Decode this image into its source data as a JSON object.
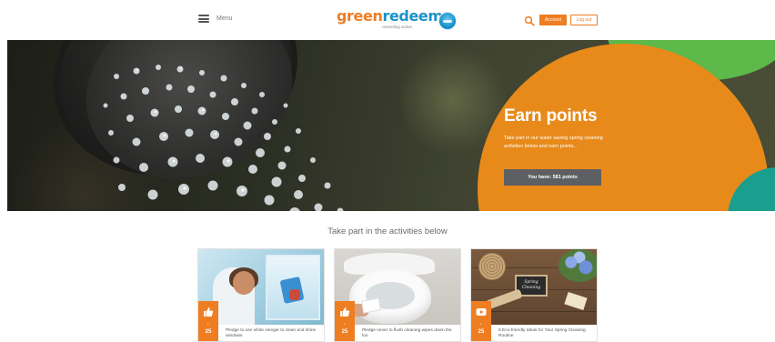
{
  "header": {
    "menu_label": "Menu",
    "logo": {
      "part1": "green",
      "part2": "redeem",
      "tagline": "rewarding action"
    },
    "account_label": "Account",
    "logout_label": "Log out"
  },
  "hero": {
    "title": "Earn points",
    "text": "Take part in our water saving spring cleaning activities below and earn points...",
    "points_button": "You have: 581 points"
  },
  "activities": {
    "title": "Take part in the activities below",
    "cards": [
      {
        "points": "25",
        "icon": "thumbs-up-icon",
        "text": "Pledge to use white vinegar to clean and shine windows"
      },
      {
        "points": "25",
        "icon": "thumbs-up-icon",
        "text": "Pledge never to flush cleaning wipes down the loo"
      },
      {
        "points": "25",
        "icon": "play-icon",
        "text": "5 Eco-friendly Ideas for Your Spring Cleaning Routine",
        "image_sign": "Spring Cleaning"
      }
    ]
  },
  "colors": {
    "brand_orange": "#ef7d22",
    "brand_blue": "#1a93c9",
    "hero_orange": "#e88a1a",
    "points_button": "#5d5f62"
  }
}
